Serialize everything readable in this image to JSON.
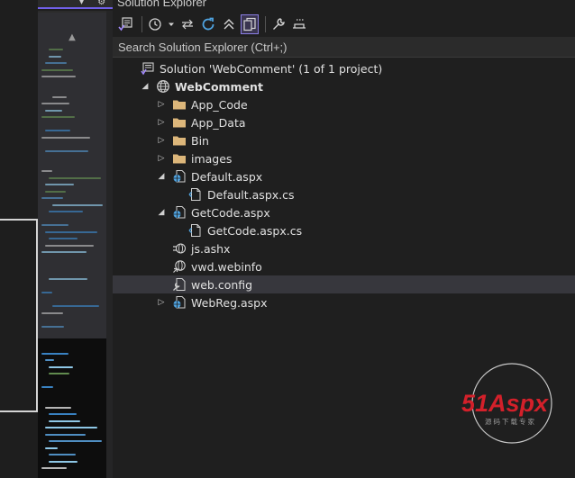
{
  "explorer": {
    "title": "Solution Explorer",
    "search_placeholder": "Search Solution Explorer (Ctrl+;)",
    "toolbar": [
      {
        "name": "vs-home-icon"
      },
      {
        "name": "history-icon"
      },
      {
        "name": "dropdown-icon"
      },
      {
        "name": "sync-icon"
      },
      {
        "name": "refresh-icon"
      },
      {
        "name": "collapse-all-icon"
      },
      {
        "name": "show-all-files-icon",
        "active": true
      },
      {
        "name": "properties-wrench-icon"
      },
      {
        "name": "preview-icon"
      }
    ]
  },
  "tree": [
    {
      "label": "Solution 'WebComment' (1 of 1 project)",
      "indent": 0,
      "expander": "",
      "icon": "solution-icon",
      "bold": false
    },
    {
      "label": "WebComment",
      "indent": 1,
      "expander": "expanded",
      "icon": "globe-icon",
      "bold": true
    },
    {
      "label": "App_Code",
      "indent": 2,
      "expander": "collapsed",
      "icon": "folder-icon",
      "bold": false
    },
    {
      "label": "App_Data",
      "indent": 2,
      "expander": "collapsed",
      "icon": "folder-icon",
      "bold": false
    },
    {
      "label": "Bin",
      "indent": 2,
      "expander": "collapsed",
      "icon": "folder-icon",
      "bold": false
    },
    {
      "label": "images",
      "indent": 2,
      "expander": "collapsed",
      "icon": "folder-icon",
      "bold": false
    },
    {
      "label": "Default.aspx",
      "indent": 2,
      "expander": "expanded",
      "icon": "aspx-page-icon",
      "bold": false
    },
    {
      "label": "Default.aspx.cs",
      "indent": 3,
      "expander": "",
      "icon": "code-file-icon",
      "bold": false
    },
    {
      "label": "GetCode.aspx",
      "indent": 2,
      "expander": "expanded",
      "icon": "aspx-page-icon",
      "bold": false
    },
    {
      "label": "GetCode.aspx.cs",
      "indent": 3,
      "expander": "",
      "icon": "code-file-icon",
      "bold": false
    },
    {
      "label": "js.ashx",
      "indent": 2,
      "expander": "",
      "icon": "handler-icon",
      "bold": false
    },
    {
      "label": "vwd.webinfo",
      "indent": 2,
      "expander": "",
      "icon": "webinfo-icon",
      "bold": false
    },
    {
      "label": "web.config",
      "indent": 2,
      "expander": "",
      "icon": "config-icon",
      "bold": false,
      "selected": true
    },
    {
      "label": "WebReg.aspx",
      "indent": 2,
      "expander": "collapsed",
      "icon": "aspx-page-icon",
      "bold": false
    }
  ],
  "colors": {
    "accent": "#7160e8",
    "folder": "#dcb67a",
    "globe": "#c8c8c8",
    "aspx_blue": "#4fa3e0",
    "selection": "#37373d",
    "logo_red": "#d3202a",
    "logo_green": "#2e8b2e"
  },
  "watermark": {
    "main": "51Aspx",
    "sub": "源码下载专家"
  }
}
